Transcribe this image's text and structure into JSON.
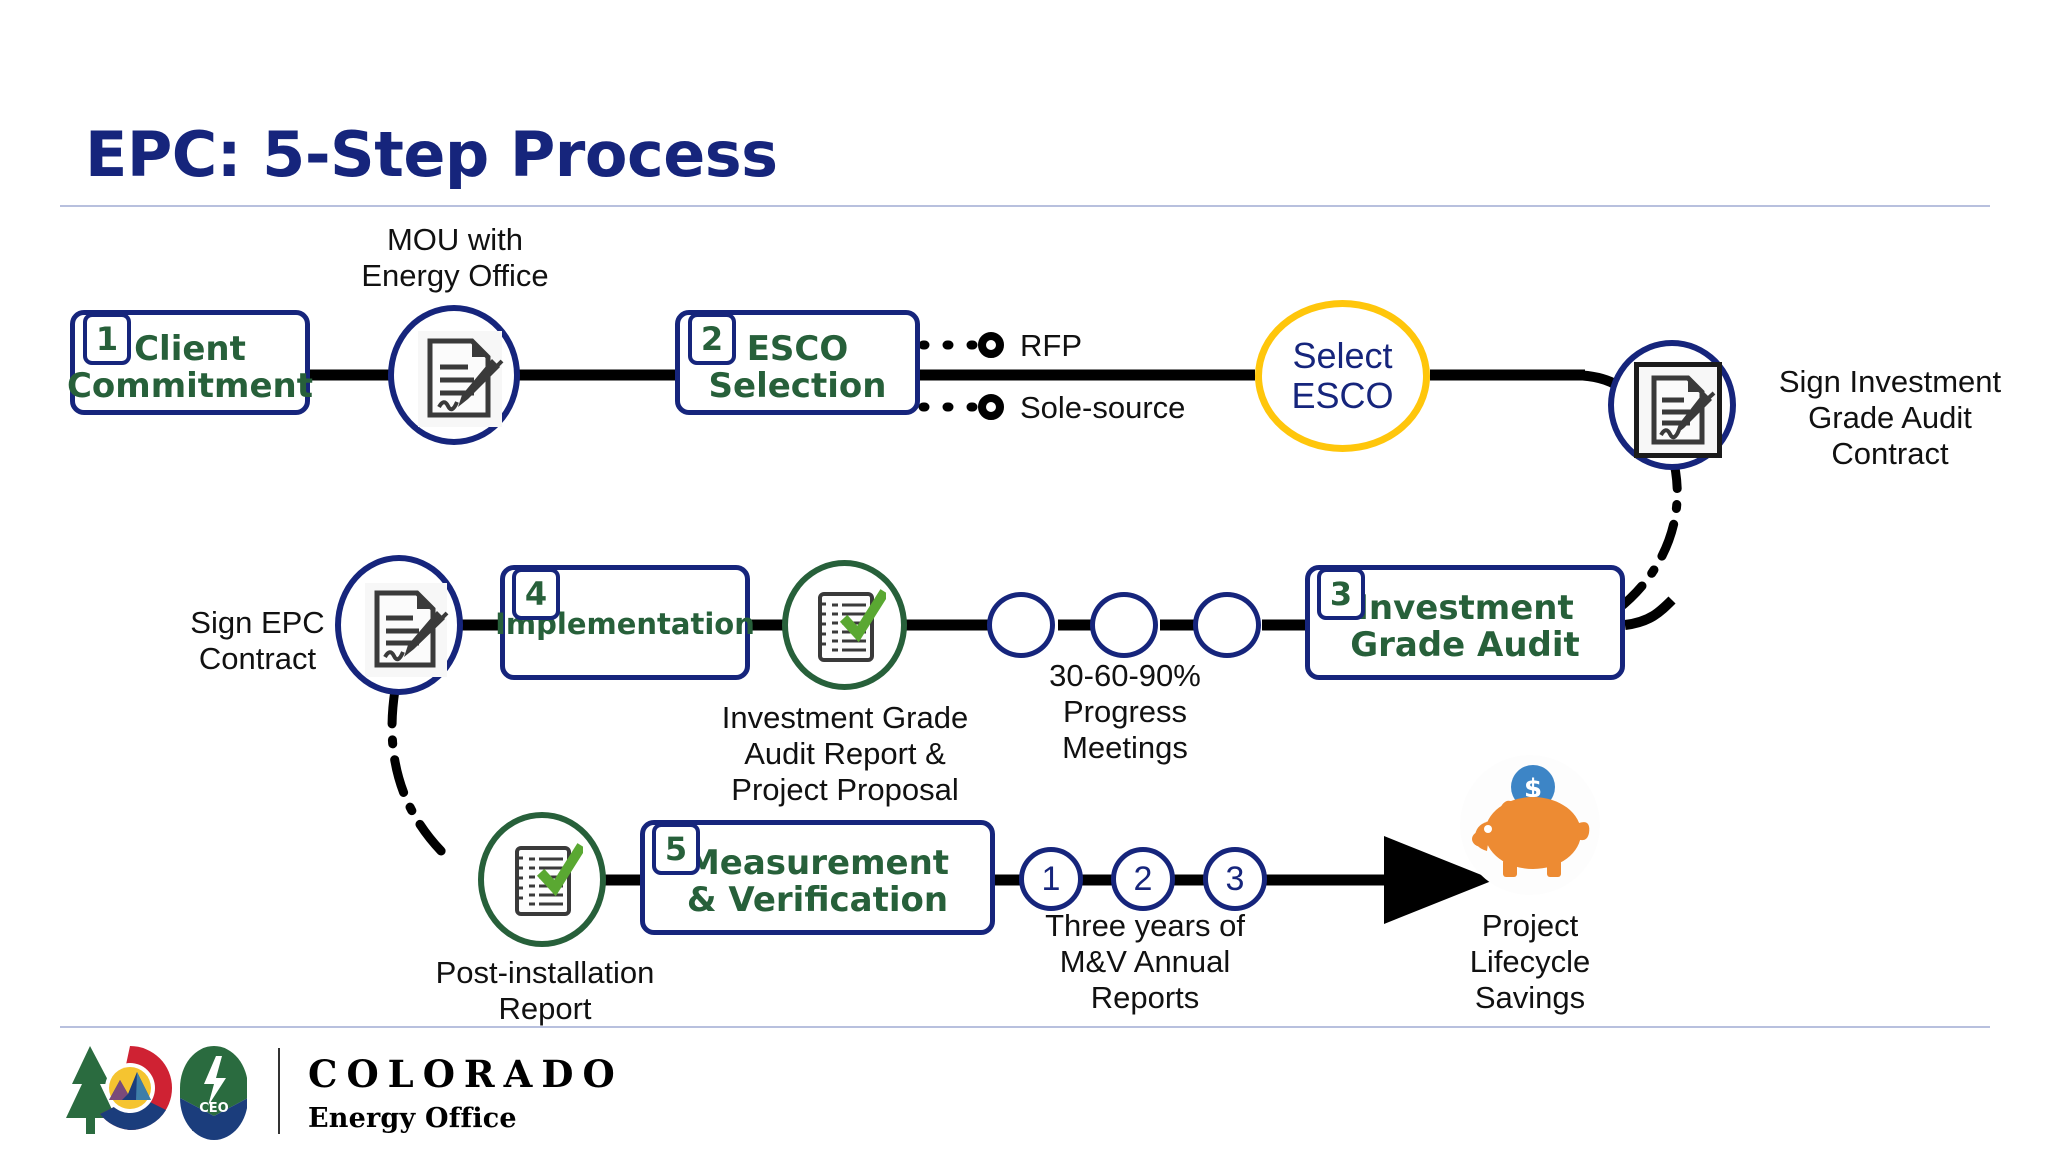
{
  "slide": {
    "title": "EPC: 5-Step Process"
  },
  "colors": {
    "navy": "#16257c",
    "green": "#27603a",
    "gold": "#ffc60b",
    "check_green": "#5aa832",
    "piggy_orange": "#ed8b33",
    "coin_blue": "#3d85c6",
    "rule": "#b8c0de",
    "line_black": "#000000"
  },
  "steps": [
    {
      "number": "1",
      "label": "Client\nCommitment"
    },
    {
      "number": "2",
      "label": "ESCO\nSelection"
    },
    {
      "number": "3",
      "label": "Investment\nGrade Audit"
    },
    {
      "number": "4",
      "label": "Implementation"
    },
    {
      "number": "5",
      "label": "Measurement\n& Verification"
    }
  ],
  "captions": {
    "mou": "MOU with\nEnergy Office",
    "rfp": "RFP",
    "sole_source": "Sole-source",
    "select_esco": "Select\nESCO",
    "sign_iga_contract": "Sign Investment\nGrade Audit\nContract",
    "sign_epc_contract": "Sign EPC\nContract",
    "iga_report": "Investment Grade\nAudit Report &\nProject Proposal",
    "progress_meetings": "30-60-90%\nProgress\nMeetings",
    "post_install_report": "Post-installation\nReport",
    "mv_annual_reports": "Three years of\nM&V Annual\nReports",
    "project_savings": "Project\nLifecycle\nSavings"
  },
  "mv_year_markers": [
    "1",
    "2",
    "3"
  ],
  "icons": {
    "mou_doc": "signature-document-icon",
    "iga_contract_doc": "signature-document-icon",
    "epc_contract_doc": "signature-document-icon",
    "iga_report_check": "checklist-check-icon",
    "post_install_check": "checklist-check-icon",
    "savings": "piggy-bank-icon",
    "coin": "dollar-coin-icon"
  },
  "footer": {
    "state_name": "COLORADO",
    "office_name": "Energy Office",
    "emblem_label": "CEO",
    "trademark": "™"
  }
}
